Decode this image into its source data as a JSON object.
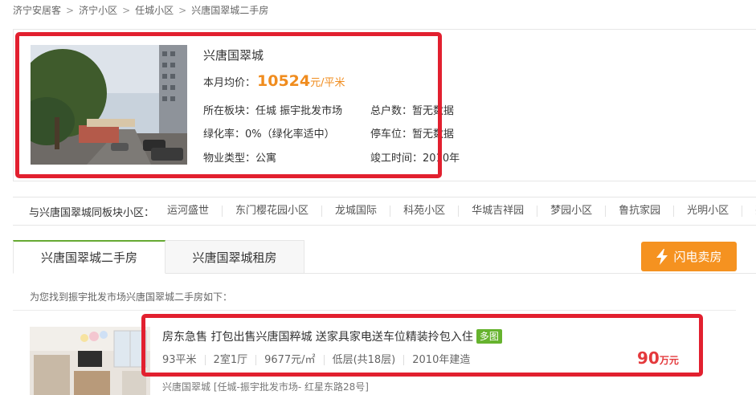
{
  "breadcrumb": {
    "items": [
      "济宁安居客",
      "济宁小区",
      "任城小区",
      "兴唐国翠城二手房"
    ],
    "separator": ">"
  },
  "community": {
    "name": "兴唐国翠城",
    "avg_label": "本月均价：",
    "avg_price": "10524",
    "avg_unit": "元/平米",
    "fields": {
      "district_label": "所在板块：",
      "district_value": "任城 振宇批发市场",
      "total_label": "总户数：",
      "total_value": "暂无数据",
      "green_label": "绿化率：",
      "green_value": "0%（绿化率适中）",
      "parking_label": "停车位：",
      "parking_value": "暂无数据",
      "type_label": "物业类型：",
      "type_value": "公寓",
      "completion_label": "竣工时间：",
      "completion_value": "2010年"
    }
  },
  "nearby": {
    "label": "与兴唐国翠城同板块小区：",
    "items": [
      "运河盛世",
      "东门樱花园小区",
      "龙城国际",
      "科苑小区",
      "华城吉祥园",
      "梦园小区",
      "鲁抗家园",
      "光明小区",
      "兴"
    ]
  },
  "tabs": {
    "active": "兴唐国翠城二手房",
    "inactive": "兴唐国翠城租房"
  },
  "sell_button": {
    "label": "闪电卖房"
  },
  "result_note": "为您找到振宇批发市场兴唐国翠城二手房如下：",
  "listing": {
    "title": "房东急售 打包出售兴唐国粹城 送家具家电送车位精装拎包入住",
    "badge": "多图",
    "attrs": [
      "93平米",
      "2室1厅",
      "9677元/㎡",
      "低层(共18层)",
      "2010年建造"
    ],
    "price": "90",
    "price_unit": "万元",
    "address": "兴唐国翠城 [任城-振宇批发市场- 红星东路28号]"
  },
  "colors": {
    "accent_orange": "#f08c1e",
    "sell_button": "#f59220",
    "price_red": "#e4393c",
    "tab_green": "#66aa33",
    "highlight_red": "#e2202f"
  }
}
